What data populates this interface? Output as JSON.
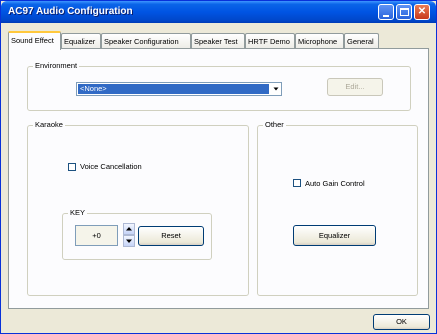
{
  "window": {
    "title": "AC97 Audio Configuration",
    "controls": {
      "minimize": "minimize-icon",
      "maximize": "maximize-icon",
      "close": "close-icon"
    }
  },
  "tabs": [
    {
      "label": "Sound Effect",
      "active": true
    },
    {
      "label": "Equalizer",
      "active": false
    },
    {
      "label": "Speaker Configuration",
      "active": false
    },
    {
      "label": "Speaker Test",
      "active": false
    },
    {
      "label": "HRTF Demo",
      "active": false
    },
    {
      "label": "Microphone",
      "active": false
    },
    {
      "label": "General",
      "active": false
    }
  ],
  "environment": {
    "group_label": "Environment",
    "selected": "<None>",
    "edit_label": "Edit...",
    "edit_enabled": false
  },
  "karaoke": {
    "group_label": "Karaoke",
    "voice_cancellation_label": "Voice Cancellation",
    "voice_cancellation_checked": false,
    "key": {
      "group_label": "KEY",
      "value": "+0",
      "reset_label": "Reset"
    }
  },
  "other": {
    "group_label": "Other",
    "auto_gain_label": "Auto Gain Control",
    "auto_gain_checked": false,
    "equalizer_label": "Equalizer"
  },
  "footer": {
    "ok_label": "OK"
  },
  "colors": {
    "titlebar": "#0054e3",
    "selection": "#316ac5",
    "face": "#ece9d8",
    "panel": "#fcfcfe"
  }
}
